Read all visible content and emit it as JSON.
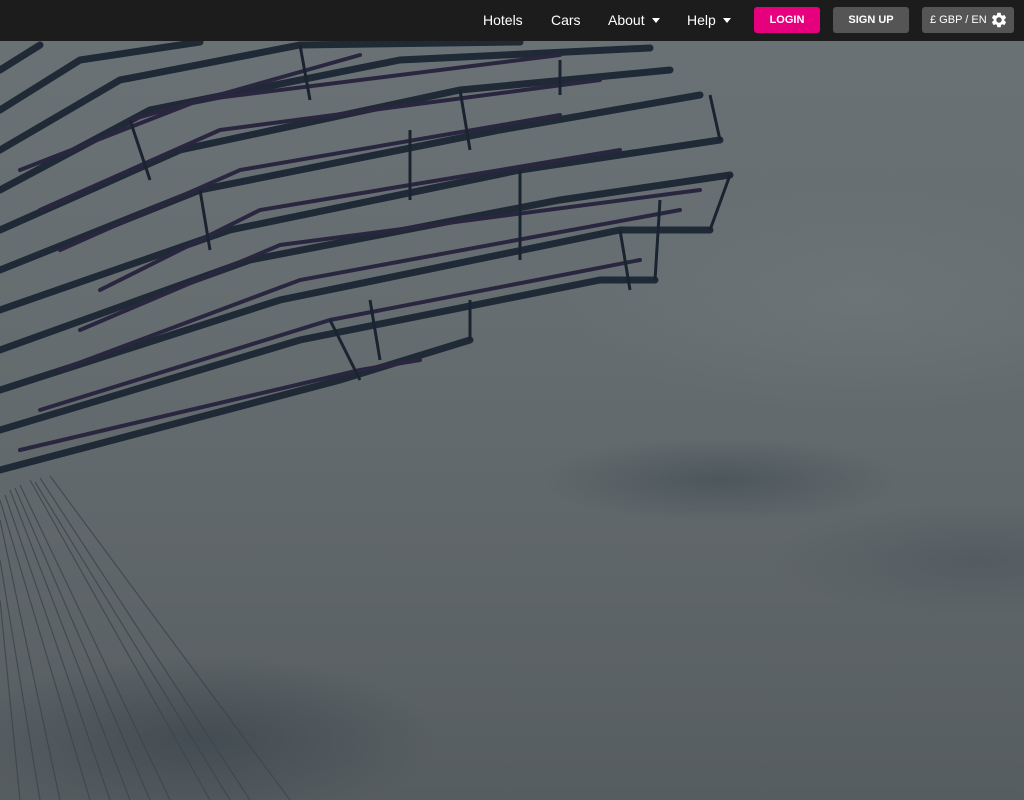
{
  "nav": {
    "links": [
      {
        "label": "Hotels"
      },
      {
        "label": "Cars"
      },
      {
        "label": "About",
        "has_dropdown": true
      },
      {
        "label": "Help",
        "has_dropdown": true
      }
    ],
    "login_label": "LOGIN",
    "signup_label": "SIGN UP",
    "locale_label": "£ GBP / EN",
    "settings_icon": "gear-icon"
  },
  "colors": {
    "navbar_bg": "#1c1c1c",
    "accent": "#e6007e",
    "secondary_button": "#555555"
  },
  "hero": {
    "image": "hero-background-image"
  }
}
